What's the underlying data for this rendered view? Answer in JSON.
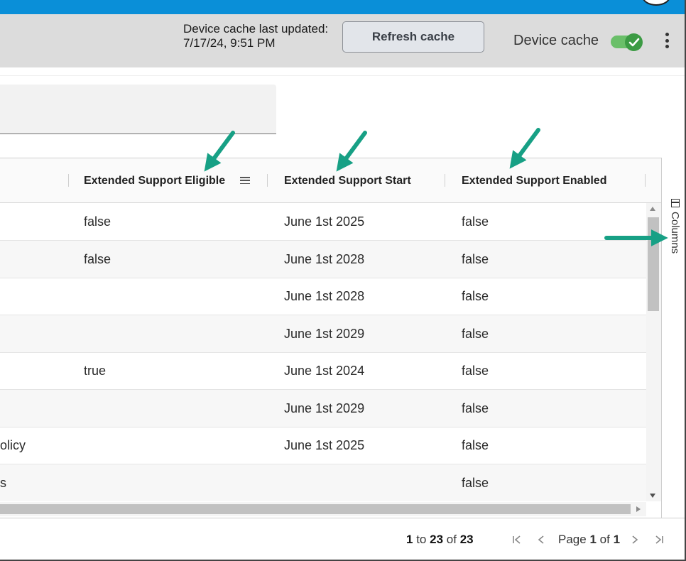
{
  "header": {
    "cache_label_line1": "Device cache last updated:",
    "cache_label_line2": "7/17/24, 9:51 PM",
    "refresh_button": "Refresh cache",
    "device_cache_label": "Device cache",
    "toggle_on": true,
    "accent_color": "#3c9b44"
  },
  "grid": {
    "columns": [
      {
        "label": "Extended Support Eligible"
      },
      {
        "label": "Extended Support Start"
      },
      {
        "label": "Extended Support Enabled"
      }
    ],
    "rows": [
      {
        "left": "",
        "eligible": "false",
        "start": "June 1st 2025",
        "enabled": "false"
      },
      {
        "left": "",
        "eligible": "false",
        "start": "June 1st 2028",
        "enabled": "false"
      },
      {
        "left": "",
        "eligible": "",
        "start": "June 1st 2028",
        "enabled": "false"
      },
      {
        "left": "",
        "eligible": "",
        "start": "June 1st 2029",
        "enabled": "false"
      },
      {
        "left": "",
        "eligible": "true",
        "start": "June 1st 2024",
        "enabled": "false"
      },
      {
        "left": "",
        "eligible": "",
        "start": "June 1st 2029",
        "enabled": "false"
      },
      {
        "left": "olicy",
        "eligible": "",
        "start": "June 1st 2025",
        "enabled": "false"
      },
      {
        "left": "s",
        "eligible": "",
        "start": "",
        "enabled": "false"
      }
    ]
  },
  "side_panel": {
    "columns_tab": "Columns"
  },
  "footer": {
    "range_start": "1",
    "to_word": "to",
    "range_end": "23",
    "of_word": "of",
    "total": "23",
    "page_word": "Page",
    "page_current": "1",
    "page_of_word": "of",
    "page_total": "1"
  },
  "annotation_color": "#17a085"
}
